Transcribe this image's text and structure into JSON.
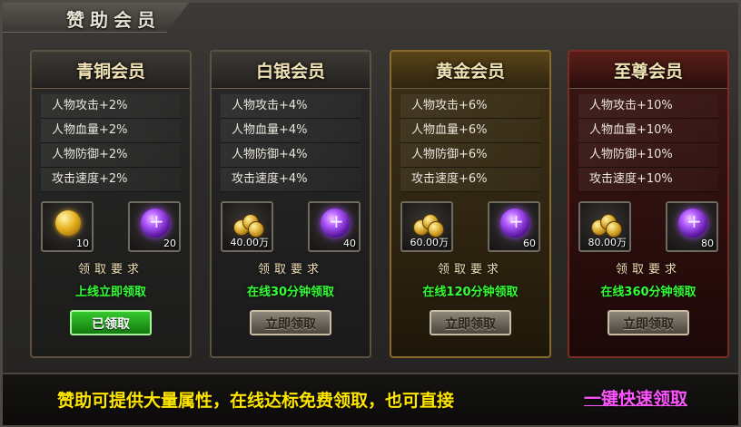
{
  "window": {
    "title": "赞助会员"
  },
  "colors": {
    "accent_green": "#32ff32",
    "gold_text": "#ffe600",
    "magenta_link": "#ff54ff"
  },
  "tiers": [
    {
      "name": "青铜会员",
      "attributes": [
        "人物攻击+2%",
        "人物血量+2%",
        "人物防御+2%",
        "攻击速度+2%"
      ],
      "rewards": [
        {
          "icon": "gold-ingot-icon",
          "qty": "10"
        },
        {
          "icon": "purple-gem-icon",
          "qty": "20"
        }
      ],
      "requirement_label": "领取要求",
      "requirement": "上线立即领取",
      "button": "已领取",
      "status": "claimed"
    },
    {
      "name": "白银会员",
      "attributes": [
        "人物攻击+4%",
        "人物血量+4%",
        "人物防御+4%",
        "攻击速度+4%"
      ],
      "rewards": [
        {
          "icon": "gold-coins-icon",
          "qty": "40.00万"
        },
        {
          "icon": "purple-gem-icon",
          "qty": "40"
        }
      ],
      "requirement_label": "领取要求",
      "requirement": "在线30分钟领取",
      "button": "立即领取",
      "status": "available"
    },
    {
      "name": "黄金会员",
      "attributes": [
        "人物攻击+6%",
        "人物血量+6%",
        "人物防御+6%",
        "攻击速度+6%"
      ],
      "rewards": [
        {
          "icon": "gold-coins-icon",
          "qty": "60.00万"
        },
        {
          "icon": "purple-gem-icon",
          "qty": "60"
        }
      ],
      "requirement_label": "领取要求",
      "requirement": "在线120分钟领取",
      "button": "立即领取",
      "status": "available"
    },
    {
      "name": "至尊会员",
      "attributes": [
        "人物攻击+10%",
        "人物血量+10%",
        "人物防御+10%",
        "攻击速度+10%"
      ],
      "rewards": [
        {
          "icon": "gold-coins-icon",
          "qty": "80.00万"
        },
        {
          "icon": "purple-gem-icon",
          "qty": "80"
        }
      ],
      "requirement_label": "领取要求",
      "requirement": "在线360分钟领取",
      "button": "立即领取",
      "status": "available"
    }
  ],
  "footer": {
    "message": "赞助可提供大量属性，在线达标免费领取，也可直接",
    "quick_claim": "一键快速领取"
  }
}
